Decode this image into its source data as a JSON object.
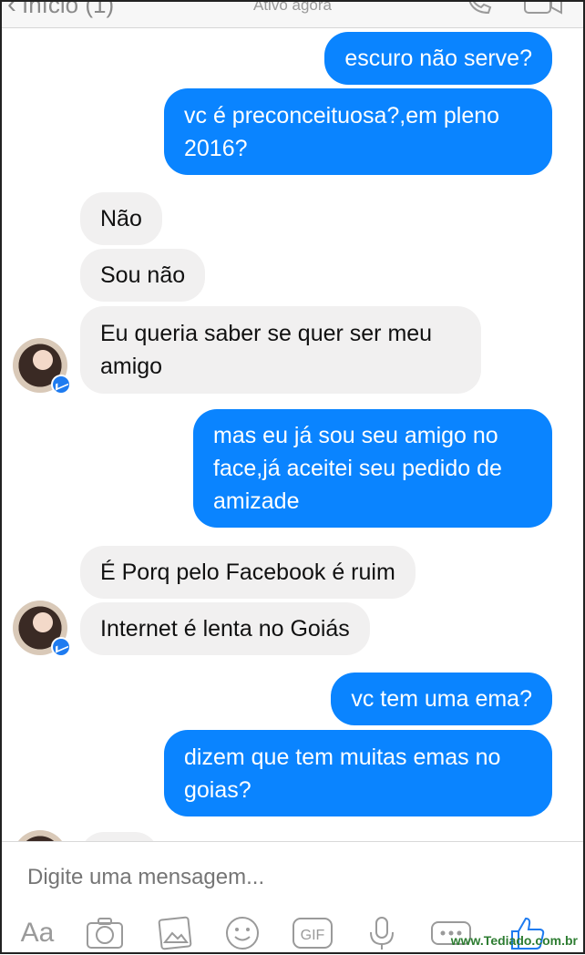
{
  "header": {
    "back_label": "Início (1)",
    "status": "Ativo agora"
  },
  "messages": [
    {
      "side": "sent",
      "text": "escuro não serve?"
    },
    {
      "side": "sent",
      "text": "vc é preconceituosa?,em pleno\n2016?"
    },
    {
      "side": "received",
      "text": "Não"
    },
    {
      "side": "received",
      "text": "Sou não"
    },
    {
      "side": "received",
      "text": "Eu queria saber se quer ser meu\namigo"
    },
    {
      "side": "sent",
      "text": "mas eu já sou seu amigo no\nface,já aceitei seu pedido de\namizade"
    },
    {
      "side": "received",
      "text": "É Porq pelo Facebook é ruim"
    },
    {
      "side": "received",
      "text": "Internet é lenta no Goiás"
    },
    {
      "side": "sent",
      "text": "vc tem uma ema?"
    },
    {
      "side": "sent",
      "text": "dizem que tem muitas emas no\ngoias?"
    }
  ],
  "composer": {
    "placeholder": "Digite uma mensagem...",
    "aa_label": "Aa",
    "gif_label": "GIF",
    "icons": [
      "camera-icon",
      "photo-icon",
      "emoji-icon",
      "gif-icon",
      "microphone-icon",
      "more-icon",
      "like-icon"
    ]
  },
  "watermark": "www.Tediado.com.br",
  "colors": {
    "sent_bubble": "#0a84ff",
    "received_bubble": "#f1f0f0",
    "messenger_badge": "#1e7bf0"
  }
}
